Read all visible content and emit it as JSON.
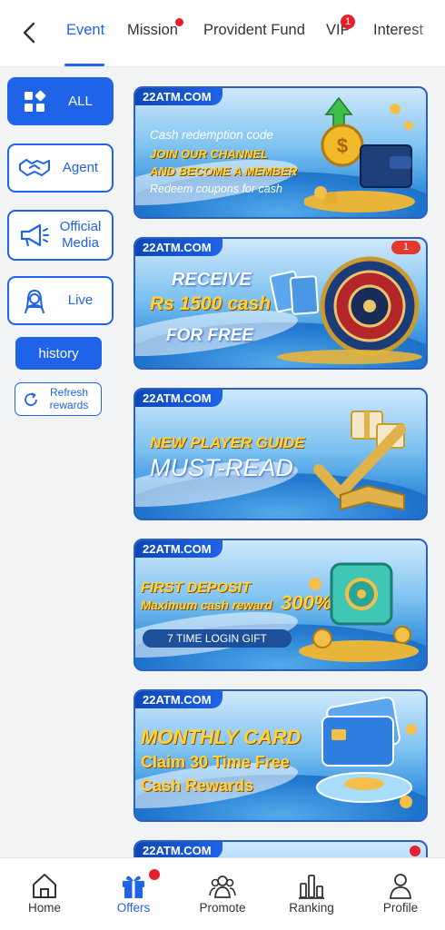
{
  "header": {
    "tabs": [
      {
        "label": "Event",
        "active": true
      },
      {
        "label": "Mission",
        "dot": true
      },
      {
        "label": "Provident Fund"
      },
      {
        "label": "VIP",
        "badge": "1"
      },
      {
        "label": "Interest"
      }
    ]
  },
  "sidebar": {
    "items": [
      {
        "label": "ALL",
        "icon": "grid-icon",
        "active": true
      },
      {
        "label": "Agent",
        "icon": "handshake-icon"
      },
      {
        "label": "Official Media",
        "icon": "megaphone-icon"
      },
      {
        "label": "Live",
        "icon": "woman-avatar-icon"
      }
    ],
    "history_label": "history",
    "refresh_label": "Refresh rewards"
  },
  "banners": [
    {
      "brand": "22ATM.COM",
      "lines": [
        "Cash redemption code",
        "JOIN OUR CHANNEL",
        "AND BECOME A MEMBER",
        "Redeem coupons for cash"
      ]
    },
    {
      "brand": "22ATM.COM",
      "badge": "1",
      "lines": [
        "RECEIVE",
        "Rs 1500 cash",
        "FOR FREE"
      ]
    },
    {
      "brand": "22ATM.COM",
      "lines": [
        "NEW PLAYER GUIDE",
        "MUST-READ"
      ]
    },
    {
      "brand": "22ATM.COM",
      "lines": [
        "FIRST DEPOSIT",
        "Maximum cash reward",
        "300%",
        "7 TIME LOGIN GIFT"
      ]
    },
    {
      "brand": "22ATM.COM",
      "lines": [
        "MONTHLY CARD",
        "Claim 30 Time Free",
        "Cash Rewards"
      ]
    },
    {
      "brand": "22ATM.COM"
    }
  ],
  "bottom_nav": [
    {
      "label": "Home",
      "icon": "home-icon"
    },
    {
      "label": "Offers",
      "icon": "gift-icon",
      "active": true,
      "dot": true
    },
    {
      "label": "Promote",
      "icon": "people-icon"
    },
    {
      "label": "Ranking",
      "icon": "bar-chart-icon"
    },
    {
      "label": "Profile",
      "icon": "person-icon"
    }
  ],
  "colors": {
    "accent": "#1e63e8",
    "badge": "#e5202e",
    "background": "#f2f3f5"
  }
}
